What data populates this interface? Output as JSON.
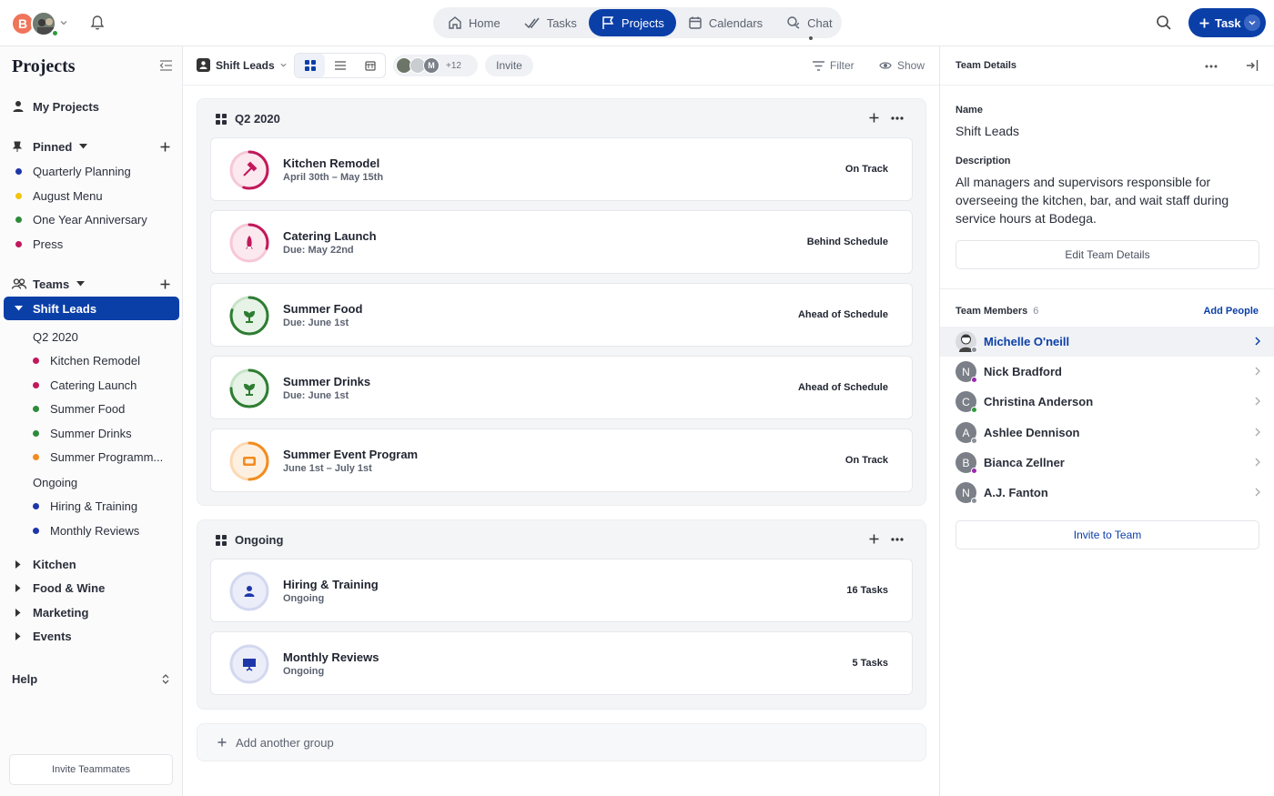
{
  "header": {
    "user_initial": "B",
    "nav": [
      {
        "label": "Home",
        "icon": "home-icon"
      },
      {
        "label": "Tasks",
        "icon": "tasks-icon"
      },
      {
        "label": "Projects",
        "icon": "flag-icon",
        "active": true
      },
      {
        "label": "Calendars",
        "icon": "calendar-icon"
      },
      {
        "label": "Chat",
        "icon": "chat-icon"
      }
    ],
    "task_button": "Task",
    "accent": "#0b3fa8"
  },
  "sidebar": {
    "title": "Projects",
    "my_projects": "My Projects",
    "pinned_label": "Pinned",
    "pinned": [
      {
        "label": "Quarterly Planning",
        "color": "#1e36a8"
      },
      {
        "label": "August Menu",
        "color": "#f2c40f"
      },
      {
        "label": "One Year Anniversary",
        "color": "#2e8b3a"
      },
      {
        "label": "Press",
        "color": "#c2185b"
      }
    ],
    "teams_label": "Teams",
    "active_team": "Shift Leads",
    "team_groups": [
      {
        "label": "Q2 2020",
        "items": [
          {
            "label": "Kitchen Remodel",
            "color": "#c2185b"
          },
          {
            "label": "Catering Launch",
            "color": "#c2185b"
          },
          {
            "label": "Summer Food",
            "color": "#2e8b3a"
          },
          {
            "label": "Summer Drinks",
            "color": "#2e8b3a"
          },
          {
            "label": "Summer Programm...",
            "color": "#f28c1e"
          }
        ]
      },
      {
        "label": "Ongoing",
        "items": [
          {
            "label": "Hiring & Training",
            "color": "#1e36a8"
          },
          {
            "label": "Monthly Reviews",
            "color": "#1e36a8"
          }
        ]
      }
    ],
    "other_teams": [
      "Kitchen",
      "Food & Wine",
      "Marketing",
      "Events"
    ],
    "help": "Help",
    "invite": "Invite Teammates"
  },
  "toolbar": {
    "team": "Shift Leads",
    "more_count": "+12",
    "avatar_letter": "M",
    "invite": "Invite",
    "filter": "Filter",
    "show": "Show"
  },
  "groups": [
    {
      "title": "Q2 2020",
      "cards": [
        {
          "title": "Kitchen Remodel",
          "sub": "April 30th – May 15th",
          "status": "On Track",
          "color": "#c2185b",
          "icon": "hammer-icon",
          "progress": 0.55
        },
        {
          "title": "Catering Launch",
          "sub": "Due: May 22nd",
          "status": "Behind Schedule",
          "color": "#c2185b",
          "icon": "rocket-icon",
          "progress": 0.3
        },
        {
          "title": "Summer Food",
          "sub": "Due: June 1st",
          "status": "Ahead of Schedule",
          "color": "#2e7d32",
          "icon": "plant-icon",
          "progress": 0.8
        },
        {
          "title": "Summer Drinks",
          "sub": "Due: June 1st",
          "status": "Ahead of Schedule",
          "color": "#2e7d32",
          "icon": "plant-icon",
          "progress": 0.75
        },
        {
          "title": "Summer Event Program",
          "sub": "June 1st – July 1st",
          "status": "On Track",
          "color": "#f28c1e",
          "icon": "ticket-icon",
          "progress": 0.5
        }
      ]
    },
    {
      "title": "Ongoing",
      "cards": [
        {
          "title": "Hiring & Training",
          "sub": "Ongoing",
          "status": "16 Tasks",
          "color": "#1e36a8",
          "icon": "person-icon",
          "progress": 0
        },
        {
          "title": "Monthly Reviews",
          "sub": "Ongoing",
          "status": "5 Tasks",
          "color": "#1e36a8",
          "icon": "presentation-icon",
          "progress": 0
        }
      ]
    }
  ],
  "add_group": "Add another group",
  "team_details": {
    "panel_title": "Team Details",
    "name_label": "Name",
    "name": "Shift Leads",
    "description_label": "Description",
    "description": "All managers and supervisors responsible for overseeing the kitchen, bar, and wait staff during service hours at Bodega.",
    "edit_button": "Edit Team Details",
    "members_label": "Team Members",
    "members_count": "6",
    "add_people": "Add People",
    "members": [
      {
        "name": "Michelle O'neill",
        "initial": "",
        "status": "#8a8f98",
        "avatar_color": "#d9dbdf",
        "selected": true
      },
      {
        "name": "Nick Bradford",
        "initial": "N",
        "status": "#9c27b0",
        "avatar_color": "#7a7f88"
      },
      {
        "name": "Christina Anderson",
        "initial": "C",
        "status": "#2e9a3f",
        "avatar_color": "#7a7f88"
      },
      {
        "name": "Ashlee Dennison",
        "initial": "A",
        "status": "#8a8f98",
        "avatar_color": "#7a7f88"
      },
      {
        "name": "Bianca Zellner",
        "initial": "B",
        "status": "#9c27b0",
        "avatar_color": "#7a7f88"
      },
      {
        "name": "A.J. Fanton",
        "initial": "N",
        "status": "#8a8f98",
        "avatar_color": "#7a7f88"
      }
    ],
    "invite_button": "Invite to Team"
  }
}
